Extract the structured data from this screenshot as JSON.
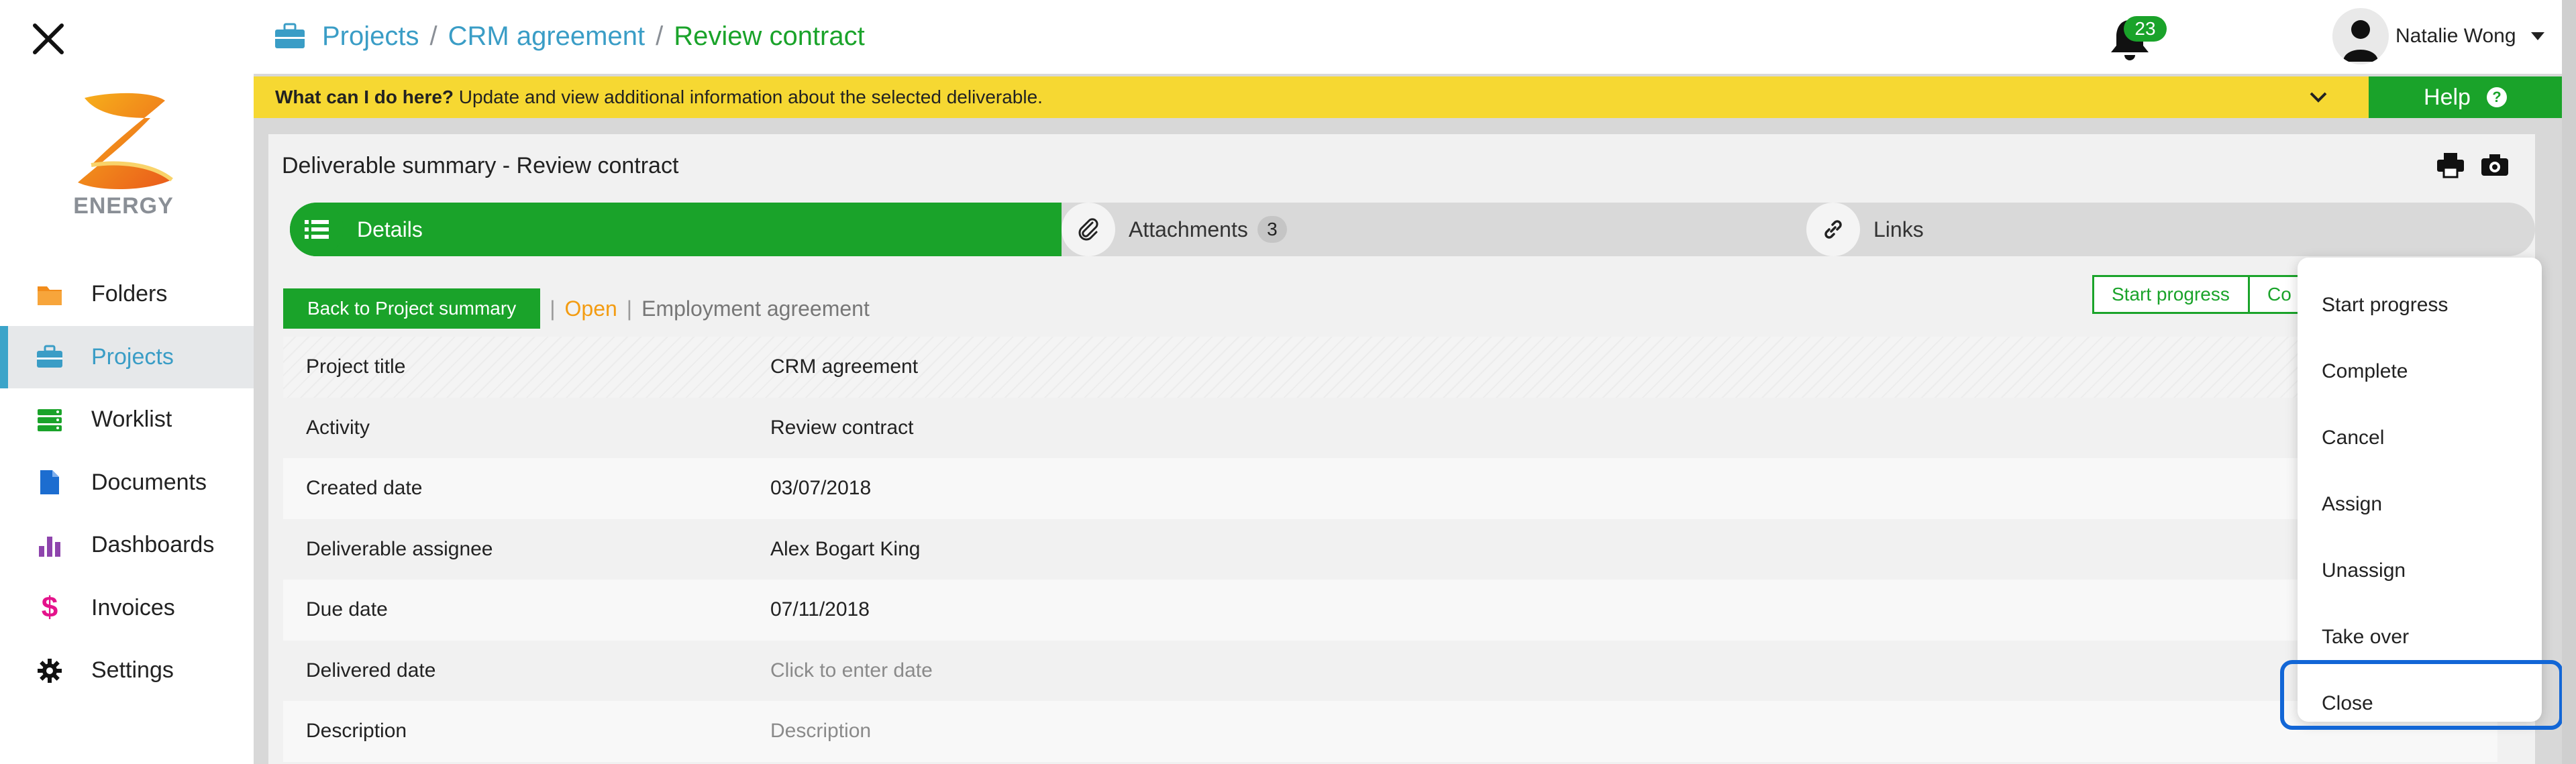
{
  "sidebar": {
    "logo_text": "ENERGY",
    "items": [
      {
        "label": "Folders",
        "icon": "folder-icon"
      },
      {
        "label": "Projects",
        "icon": "briefcase-icon",
        "active": true
      },
      {
        "label": "Worklist",
        "icon": "worklist-icon"
      },
      {
        "label": "Documents",
        "icon": "document-icon"
      },
      {
        "label": "Dashboards",
        "icon": "bar-chart-icon"
      },
      {
        "label": "Invoices",
        "icon": "dollar-icon"
      },
      {
        "label": "Settings",
        "icon": "gear-icon"
      }
    ]
  },
  "header": {
    "breadcrumb": [
      "Projects",
      "CRM agreement",
      "Review contract"
    ],
    "separator": "/",
    "notification_count": "23",
    "user_name": "Natalie Wong"
  },
  "helpbar": {
    "question": "What can I do here?",
    "text": " Update and view additional information about the selected deliverable.",
    "help_label": "Help",
    "help_icon": "?"
  },
  "panel": {
    "title": "Deliverable summary - Review contract",
    "tabs": [
      {
        "label": "Details",
        "icon": "list-icon"
      },
      {
        "label": "Attachments",
        "icon": "paperclip-icon",
        "count": "3"
      },
      {
        "label": "Links",
        "icon": "link-icon"
      }
    ],
    "back_button": "Back to Project summary",
    "sep": "|",
    "status": "Open",
    "type": "Employment agreement",
    "start_progress": "Start progress",
    "complete_truncated": "Co",
    "fields": [
      {
        "label": "Project title",
        "value": "CRM agreement"
      },
      {
        "label": "Activity",
        "value": "Review contract"
      },
      {
        "label": "Created date",
        "value": "03/07/2018"
      },
      {
        "label": "Deliverable assignee",
        "value": "Alex Bogart King"
      },
      {
        "label": "Due date",
        "value": "07/11/2018"
      },
      {
        "label": "Delivered date",
        "value": "Click to enter date",
        "placeholder": true
      },
      {
        "label": "Description",
        "value": "Description",
        "placeholder": true
      }
    ]
  },
  "dropdown": {
    "items": [
      "Start progress",
      "Complete",
      "Cancel",
      "Assign",
      "Unassign",
      "Take over",
      "Close"
    ],
    "highlighted": "Close"
  },
  "colors": {
    "green": "#1aa32a",
    "blue": "#3a9dc6",
    "yellow": "#f6d832",
    "orange": "#f39c12",
    "highlight": "#1266d6"
  }
}
